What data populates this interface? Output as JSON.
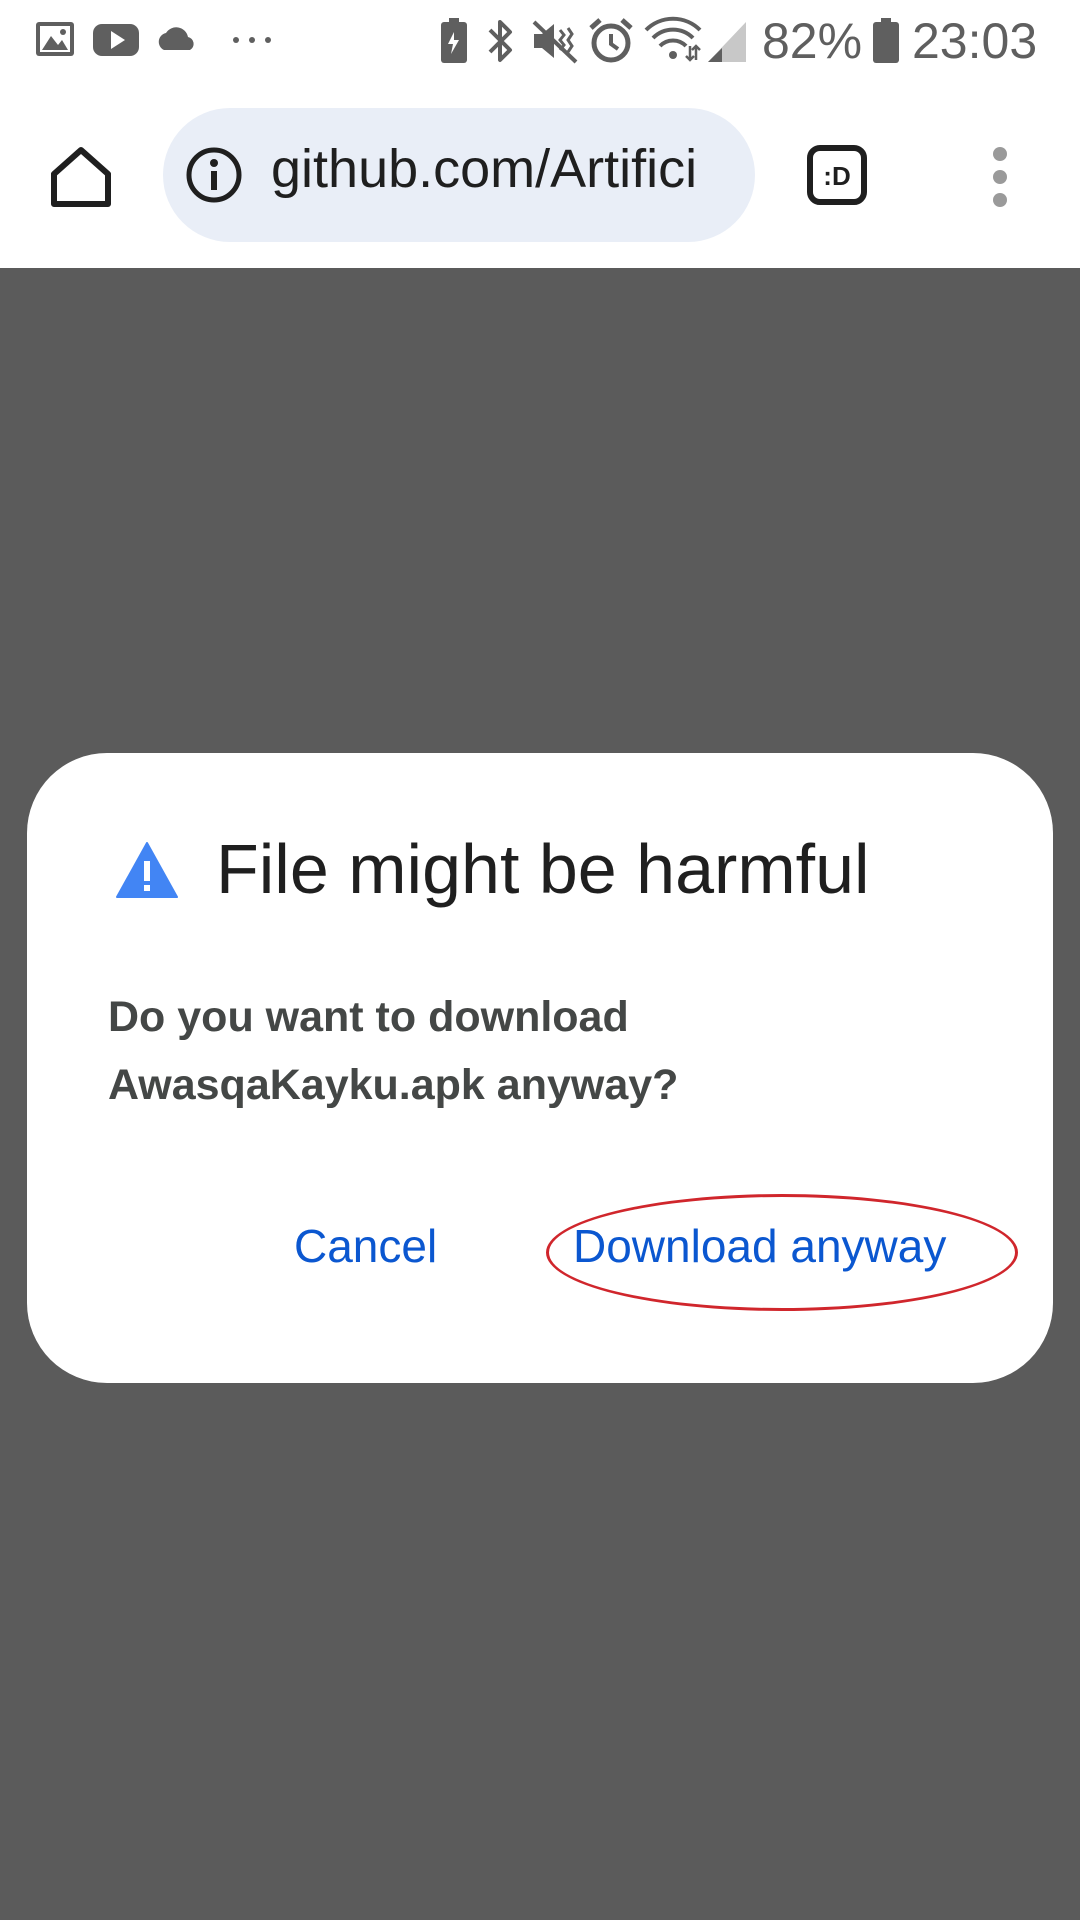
{
  "status_bar": {
    "left_icons": [
      "gallery-icon",
      "youtube-icon",
      "cloud-icon",
      "more-dots-icon"
    ],
    "right_icons": [
      "battery-saver-icon",
      "bluetooth-icon",
      "vibrate-icon",
      "alarm-icon",
      "wifi-icon",
      "signal-icon",
      "battery-icon"
    ],
    "battery_percent": "82%",
    "time": "23:03"
  },
  "browser": {
    "url": "github.com/Artifici",
    "tab_switcher_label": ":D"
  },
  "dialog": {
    "title": "File might be harmful",
    "message_line1": "Do you want to download",
    "message_line2": "AwasqaKayku.apk anyway?",
    "cancel_label": "Cancel",
    "confirm_label": "Download anyway"
  },
  "colors": {
    "accent": "#0b57d0",
    "warning_icon": "#4285f4",
    "scrim": "#5b5b5b",
    "url_bar_bg": "#e9eef7",
    "annotation_ring": "#d0262c"
  }
}
